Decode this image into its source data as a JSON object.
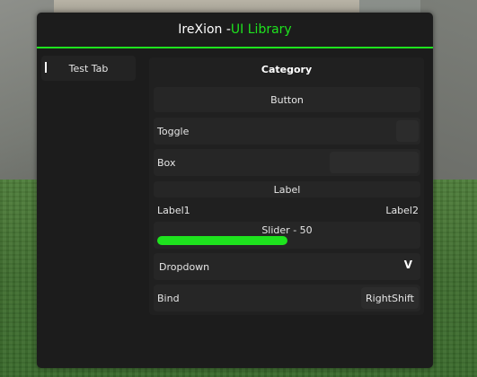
{
  "window": {
    "title_prefix": "IreXion - ",
    "title_accent": "UI Library",
    "accent_color": "#1ee31e"
  },
  "tabs": [
    {
      "label": "Test Tab",
      "selected": true
    }
  ],
  "section": {
    "title": "Category",
    "button_label": "Button",
    "toggle_label": "Toggle",
    "toggle_on": false,
    "box_label": "Box",
    "box_value": "",
    "label_text": "Label",
    "dual_label_left": "Label1",
    "dual_label_right": "Label2",
    "slider_label": "Slider - 50",
    "slider_fraction": 0.5,
    "dropdown_label": "Dropdown",
    "dropdown_icon": "V",
    "bind_label": "Bind",
    "bind_key": "RightShift"
  }
}
